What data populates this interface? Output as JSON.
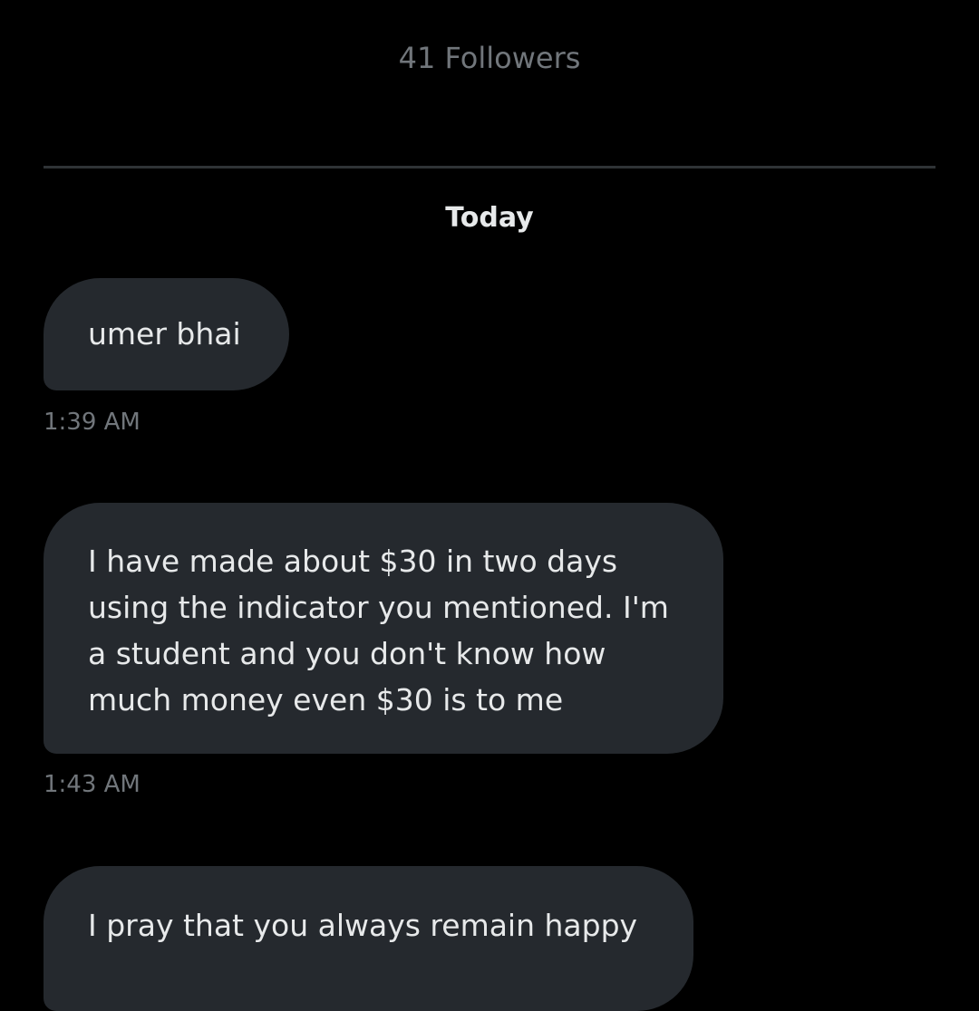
{
  "profile": {
    "followers_label": "41 Followers"
  },
  "conversation": {
    "day_label": "Today",
    "messages": [
      {
        "text": "umer bhai",
        "time": "1:39 AM"
      },
      {
        "text": "I have made about $30 in two days using the indicator you mentioned. I'm a student and you don't know how much money even $30 is to me",
        "time": "1:43 AM"
      },
      {
        "text": "I pray that you always remain happy"
      }
    ]
  },
  "colors": {
    "background": "#000000",
    "bubble": "#25292e",
    "text_primary": "#e7e9ea",
    "text_secondary": "#71767b",
    "divider": "#2f3336"
  }
}
